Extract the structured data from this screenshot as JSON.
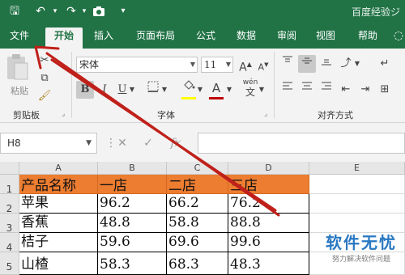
{
  "app": {
    "title": "百度经验ジ"
  },
  "quick_access": {
    "undo": "↶",
    "redo": "↷",
    "customize": "▾"
  },
  "tabs": [
    {
      "label": "文件"
    },
    {
      "label": "开始"
    },
    {
      "label": "插入"
    },
    {
      "label": "页面布局"
    },
    {
      "label": "公式"
    },
    {
      "label": "数据"
    },
    {
      "label": "审阅"
    },
    {
      "label": "视图"
    },
    {
      "label": "帮助"
    }
  ],
  "ribbon": {
    "clipboard": {
      "paste_label": "粘贴",
      "group_label": "剪贴板"
    },
    "font": {
      "name": "宋体",
      "size": "11",
      "grow": "A",
      "shrink": "A",
      "bold": "B",
      "italic": "I",
      "underline": "U",
      "phonetic": "wén",
      "group_label": "字体",
      "fill_color": "#ffff00",
      "font_color": "#c00000"
    },
    "alignment": {
      "group_label": "对齐方式"
    }
  },
  "formula_bar": {
    "name_box": "H8",
    "cancel": "✕",
    "enter": "✓",
    "fx": "fx"
  },
  "sheet": {
    "columns": [
      "A",
      "B",
      "C",
      "D",
      "E"
    ],
    "rows": [
      "1",
      "2",
      "3",
      "4",
      "5"
    ],
    "header_fill": "#ed7d31",
    "cells": [
      [
        "产品名称",
        "一店",
        "二店",
        "三店"
      ],
      [
        "苹果",
        "96.2",
        "66.2",
        "76.2"
      ],
      [
        "香蕉",
        "48.8",
        "58.8",
        "88.8"
      ],
      [
        "桔子",
        "59.6",
        "69.6",
        "99.6"
      ],
      [
        "山楂",
        "58.3",
        "68.3",
        "48.3"
      ]
    ]
  },
  "watermark": {
    "title": "软件无忧",
    "subtitle": "努力解决软件问题"
  },
  "annotation": {
    "arrow_color": "#c0201a"
  }
}
